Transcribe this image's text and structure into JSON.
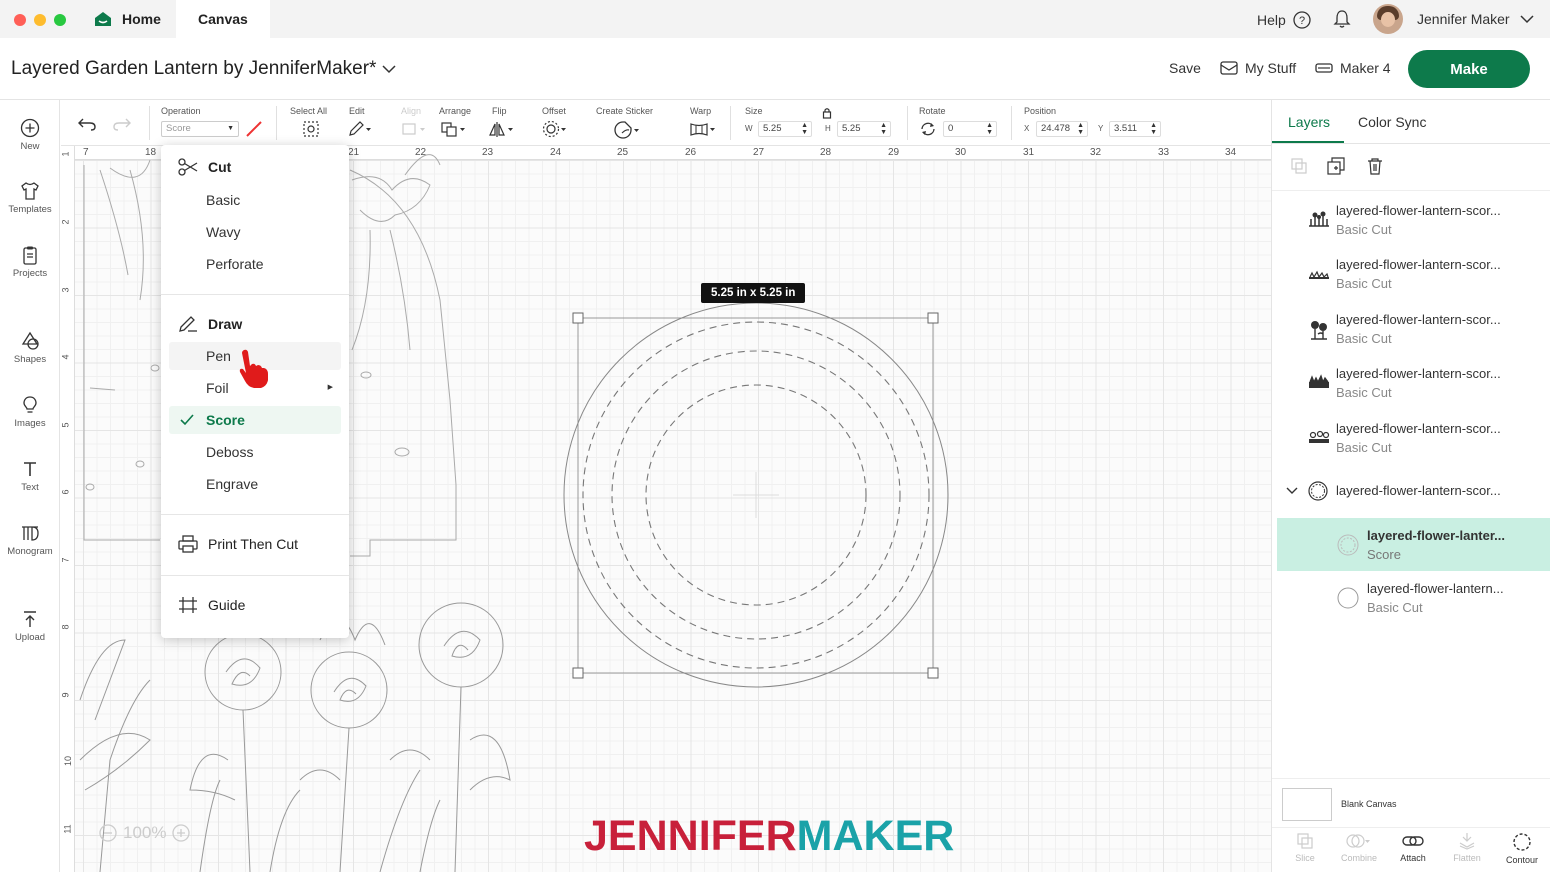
{
  "window": {
    "tabs": [
      {
        "label": "Home",
        "active": false,
        "icon": "home-icon"
      },
      {
        "label": "Canvas",
        "active": true
      }
    ],
    "help_label": "Help",
    "user_name": "Jennifer Maker"
  },
  "header": {
    "project_title": "Layered Garden Lantern by JenniferMaker*",
    "save_label": "Save",
    "my_stuff_label": "My Stuff",
    "machine_label": "Maker 4",
    "make_label": "Make",
    "accent_color": "#0d7a4b"
  },
  "sidebar": {
    "items": [
      {
        "label": "New",
        "icon": "plus-circle-icon"
      },
      {
        "label": "Templates",
        "icon": "shirt-icon"
      },
      {
        "label": "Projects",
        "icon": "clipboard-icon"
      },
      {
        "label": "Shapes",
        "icon": "shapes-icon"
      },
      {
        "label": "Images",
        "icon": "lightbulb-icon"
      },
      {
        "label": "Text",
        "icon": "text-icon"
      },
      {
        "label": "Monogram",
        "icon": "monogram-icon"
      },
      {
        "label": "Upload",
        "icon": "upload-icon"
      }
    ]
  },
  "toolbar": {
    "operation_label": "Operation",
    "operation_value": "Score",
    "select_all_label": "Select All",
    "edit_label": "Edit",
    "align_label": "Align",
    "arrange_label": "Arrange",
    "flip_label": "Flip",
    "offset_label": "Offset",
    "create_sticker_label": "Create Sticker",
    "warp_label": "Warp",
    "size_label": "Size",
    "w_label": "W",
    "w_value": "5.25",
    "h_label": "H",
    "h_value": "5.25",
    "rotate_label": "Rotate",
    "rotate_value": "0",
    "position_label": "Position",
    "x_label": "X",
    "x_value": "24.478",
    "y_label": "Y",
    "y_value": "3.511"
  },
  "ruler": {
    "top": [
      "7",
      "18",
      "21",
      "22",
      "23",
      "24",
      "25",
      "26",
      "27",
      "28",
      "29",
      "30",
      "31",
      "32",
      "33",
      "34"
    ],
    "left": [
      "1",
      "2",
      "3",
      "4",
      "5",
      "6",
      "7",
      "8",
      "9",
      "10",
      "11"
    ]
  },
  "operation_menu": {
    "cut_heading": "Cut",
    "cut_items": [
      "Basic",
      "Wavy",
      "Perforate"
    ],
    "draw_heading": "Draw",
    "draw_items": [
      "Pen",
      "Foil",
      "Score",
      "Deboss",
      "Engrave"
    ],
    "selected_item": "Score",
    "print_then_cut": "Print Then Cut",
    "guide": "Guide"
  },
  "canvas": {
    "size_tooltip": "5.25  in x 5.25  in",
    "zoom_label": "100%",
    "watermark_part1": "JENNIFER",
    "watermark_part2": "MAKER",
    "watermark_color1": "#c8203a",
    "watermark_color2": "#1aa2a8"
  },
  "right_panel": {
    "tabs": [
      "Layers",
      "Color Sync"
    ],
    "layers": [
      {
        "name": "layered-flower-lantern-scor...",
        "type": "Basic Cut",
        "thumb": "flowers-thumb-icon"
      },
      {
        "name": "layered-flower-lantern-scor...",
        "type": "Basic Cut",
        "thumb": "grass-thumb-icon"
      },
      {
        "name": "layered-flower-lantern-scor...",
        "type": "Basic Cut",
        "thumb": "flowers-thumb-icon"
      },
      {
        "name": "layered-flower-lantern-scor...",
        "type": "Basic Cut",
        "thumb": "grass-thumb-icon"
      },
      {
        "name": "layered-flower-lantern-scor...",
        "type": "Basic Cut",
        "thumb": "flowers-thumb-icon"
      }
    ],
    "group_name": "layered-flower-lantern-scor...",
    "group_children": [
      {
        "name": "layered-flower-lanter...",
        "type": "Score",
        "selected": true
      },
      {
        "name": "layered-flower-lantern...",
        "type": "Basic Cut",
        "selected": false
      }
    ],
    "blank_canvas_label": "Blank Canvas",
    "bottom_tools": [
      {
        "label": "Slice",
        "enabled": false,
        "icon": "slice-icon"
      },
      {
        "label": "Combine",
        "enabled": false,
        "icon": "combine-icon"
      },
      {
        "label": "Attach",
        "enabled": true,
        "icon": "attach-icon"
      },
      {
        "label": "Flatten",
        "enabled": false,
        "icon": "flatten-icon"
      },
      {
        "label": "Contour",
        "enabled": true,
        "icon": "contour-icon"
      }
    ]
  }
}
